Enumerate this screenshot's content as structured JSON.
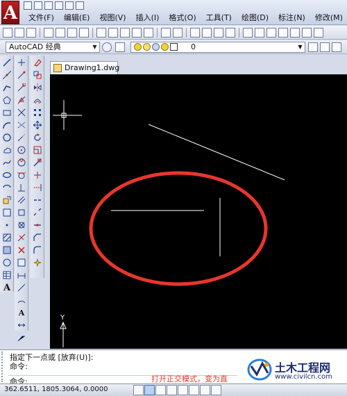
{
  "window": {
    "menu": [
      "文件(F)",
      "编辑(E)",
      "视图(V)",
      "插入(I)",
      "格式(O)",
      "工具(T)",
      "绘图(D)",
      "标注(N)",
      "修改(M)"
    ]
  },
  "toolbar": {
    "workspace_select": "AutoCAD 经典",
    "layer_select": "0"
  },
  "document": {
    "tab_title": "Drawing1.dwg"
  },
  "canvas": {
    "ucs_y_label": "Y"
  },
  "command_line": {
    "history_1": "指定下一点或 [放弃(U)]:",
    "history_2": "命令:",
    "prompt": "命令:"
  },
  "status": {
    "coordinates": "362.6511,  1805.3064, 0.0000",
    "ortho_tooltip": "打开正交模式，变为直"
  },
  "watermark": {
    "title": "土木工程网",
    "url": "www.civilcn.com"
  },
  "colors": {
    "canvas_bg": "#000000",
    "highlight_ellipse": "#e8362d",
    "line": "#ffffff"
  }
}
